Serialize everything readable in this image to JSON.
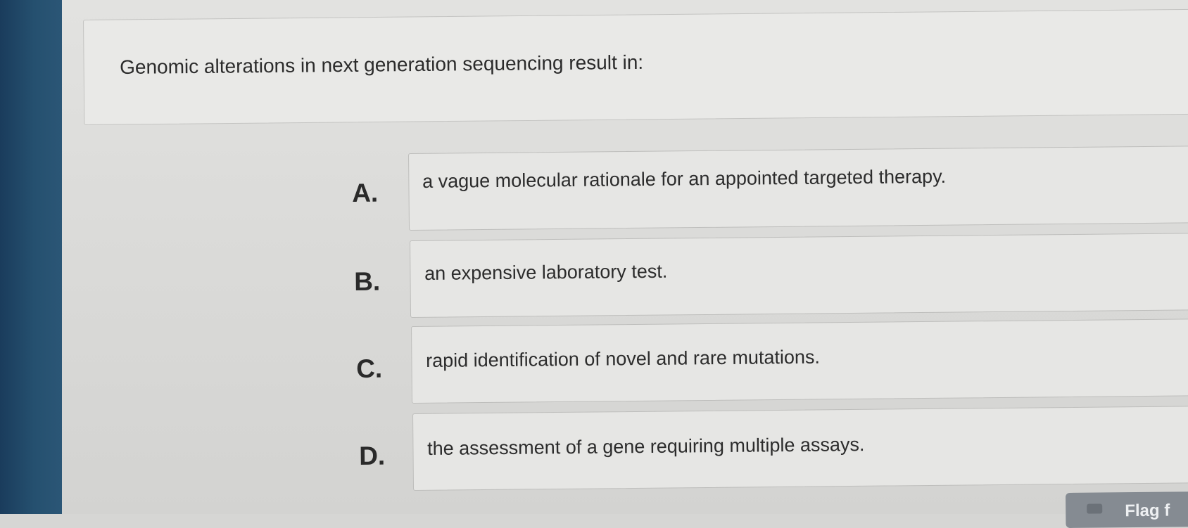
{
  "question": {
    "text": "Genomic alterations in next generation sequencing result in:"
  },
  "options": [
    {
      "letter": "A.",
      "text": "a vague molecular rationale for an appointed targeted therapy."
    },
    {
      "letter": "B.",
      "text": "an expensive laboratory test."
    },
    {
      "letter": "C.",
      "text": "rapid identification of novel and rare mutations."
    },
    {
      "letter": "D.",
      "text": "the assessment of a gene requiring multiple assays."
    }
  ],
  "flag_button": {
    "label": "Flag f"
  },
  "colors": {
    "side_bar": "#1f4566",
    "screen_background": "#dcdcda",
    "card_background": "#e6e6e4",
    "text": "#2b2b2b"
  }
}
